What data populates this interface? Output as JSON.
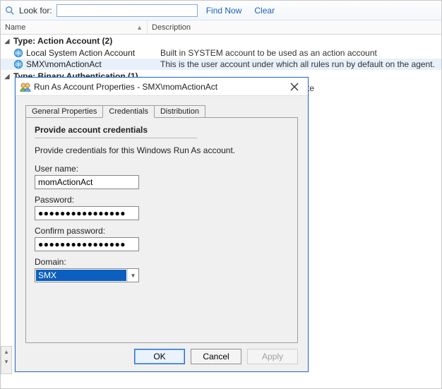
{
  "lookfor": {
    "label": "Look for:",
    "value": "",
    "find_now": "Find Now",
    "clear": "Clear"
  },
  "columns": {
    "name": "Name",
    "description": "Description"
  },
  "groups": [
    {
      "title": "Type: Action Account (2)",
      "items": [
        {
          "name": "Local System Action Account",
          "desc": "Built in SYSTEM account to be used as an action account",
          "selected": false
        },
        {
          "name": "SMX\\momActionAct",
          "desc": "This is the user account under which all rules run by default on the agent.",
          "selected": true
        }
      ]
    },
    {
      "title": "Type: Binary Authentication (1)",
      "items_hidden_behind_dialog": true,
      "visible_row_fragment_desc": "te"
    }
  ],
  "dialog": {
    "title": "Run As Account Properties - SMX\\momActionAct",
    "tabs": {
      "general": "General Properties",
      "credentials": "Credentials",
      "distribution": "Distribution"
    },
    "active_tab": "credentials",
    "section_head": "Provide account credentials",
    "hint": "Provide credentials for this Windows Run As account.",
    "labels": {
      "username": "User name:",
      "password": "Password:",
      "confirm": "Confirm password:",
      "domain": "Domain:"
    },
    "values": {
      "username": "momActionAct",
      "password": "●●●●●●●●●●●●●●●●",
      "confirm": "●●●●●●●●●●●●●●●●",
      "domain": "SMX"
    },
    "buttons": {
      "ok": "OK",
      "cancel": "Cancel",
      "apply": "Apply"
    }
  }
}
